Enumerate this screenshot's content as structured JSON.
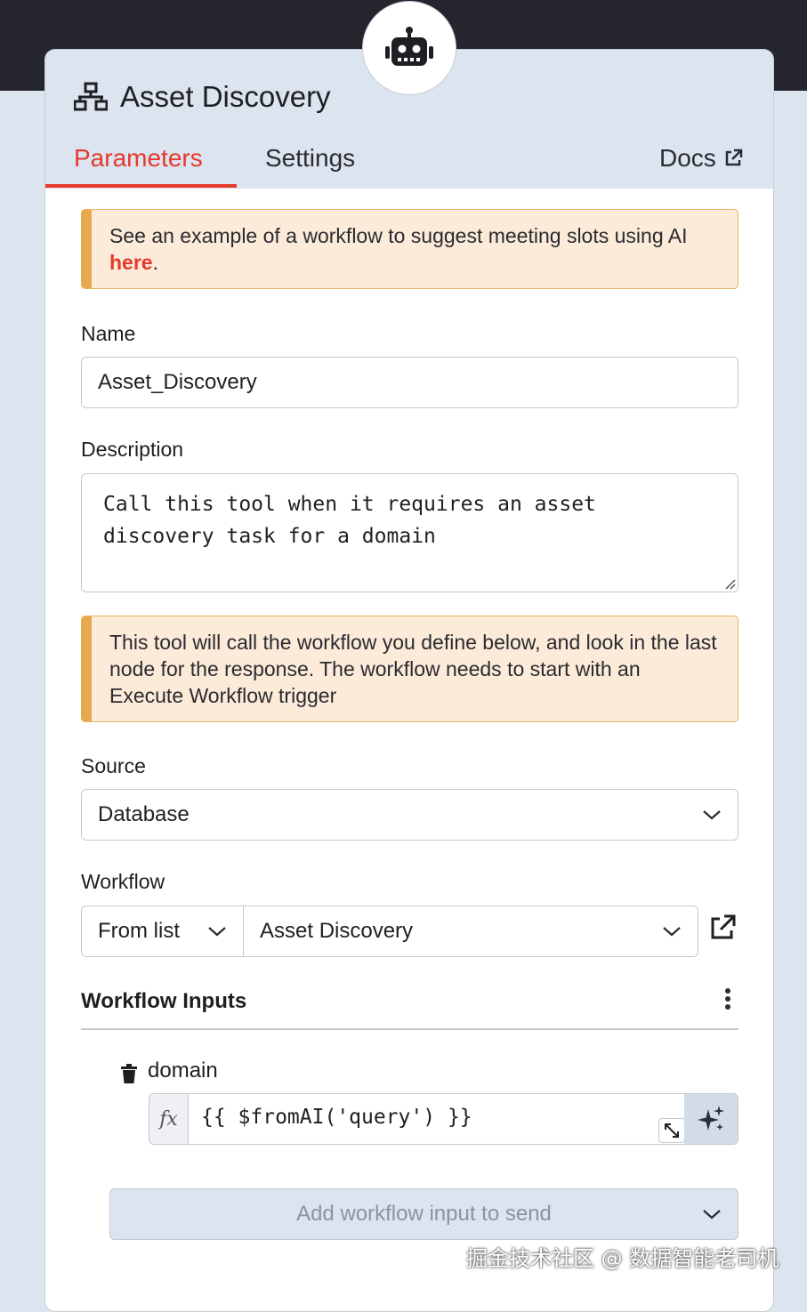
{
  "node": {
    "title": "Asset Discovery",
    "title_icon": "network-tree-icon",
    "badge_icon": "robot-icon"
  },
  "tabs": {
    "parameters": "Parameters",
    "settings": "Settings",
    "docs": "Docs",
    "active": "parameters"
  },
  "notice1": {
    "text_before": "See an example of a workflow to suggest meeting slots using AI ",
    "link": "here",
    "text_after": "."
  },
  "name": {
    "label": "Name",
    "value": "Asset_Discovery"
  },
  "description": {
    "label": "Description",
    "value": "Call this tool when it requires an asset\ndiscovery task for a domain"
  },
  "notice2": {
    "text": "This tool will call the workflow you define below, and look in the last node for the response. The workflow needs to start with an Execute Workflow trigger"
  },
  "source": {
    "label": "Source",
    "value": "Database"
  },
  "workflow": {
    "label": "Workflow",
    "mode": "From list",
    "value": "Asset Discovery"
  },
  "workflow_inputs": {
    "label": "Workflow Inputs",
    "items": [
      {
        "name": "domain",
        "fx": "fx",
        "expression": "{{ $fromAI('query') }}"
      }
    ],
    "add_label": "Add workflow input to send"
  },
  "watermark": "掘金技术社区 @ 数据智能老司机",
  "colors": {
    "accent": "#e6392b",
    "notice_bg": "#fcebd8",
    "notice_border": "#e8a84d",
    "header_bg": "#dbe4ef",
    "topbar": "#25252e"
  }
}
